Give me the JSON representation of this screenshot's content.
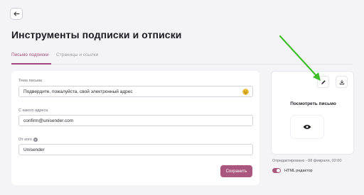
{
  "header": {
    "title": "Инструменты подписки и отписки"
  },
  "tabs": [
    {
      "label": "Письмо подписки",
      "active": true
    },
    {
      "label": "Страницы и ссылки",
      "active": false
    }
  ],
  "form": {
    "subject": {
      "label": "Тема письма",
      "value": "Подвердите, пожалуйста, свой электронный адрес"
    },
    "from_address": {
      "label": "С какого адреса",
      "value": "confirm@unisender.com"
    },
    "from_name": {
      "label": "От кого",
      "value": "Unisender"
    },
    "save_label": "Сохранить"
  },
  "preview": {
    "title": "Посмотреть письмо",
    "edited": "Отредактировано - 08 февраля, 02:00",
    "toggle_label": "HTML редактор",
    "toggle_on": true
  },
  "colors": {
    "accent": "#a9577f",
    "tab_active": "#a24a7a",
    "annotation_arrow": "#3fbf2a"
  },
  "icons": [
    "back-arrow-icon",
    "emoji-icon",
    "help-icon",
    "pencil-icon",
    "download-icon",
    "eye-icon"
  ]
}
